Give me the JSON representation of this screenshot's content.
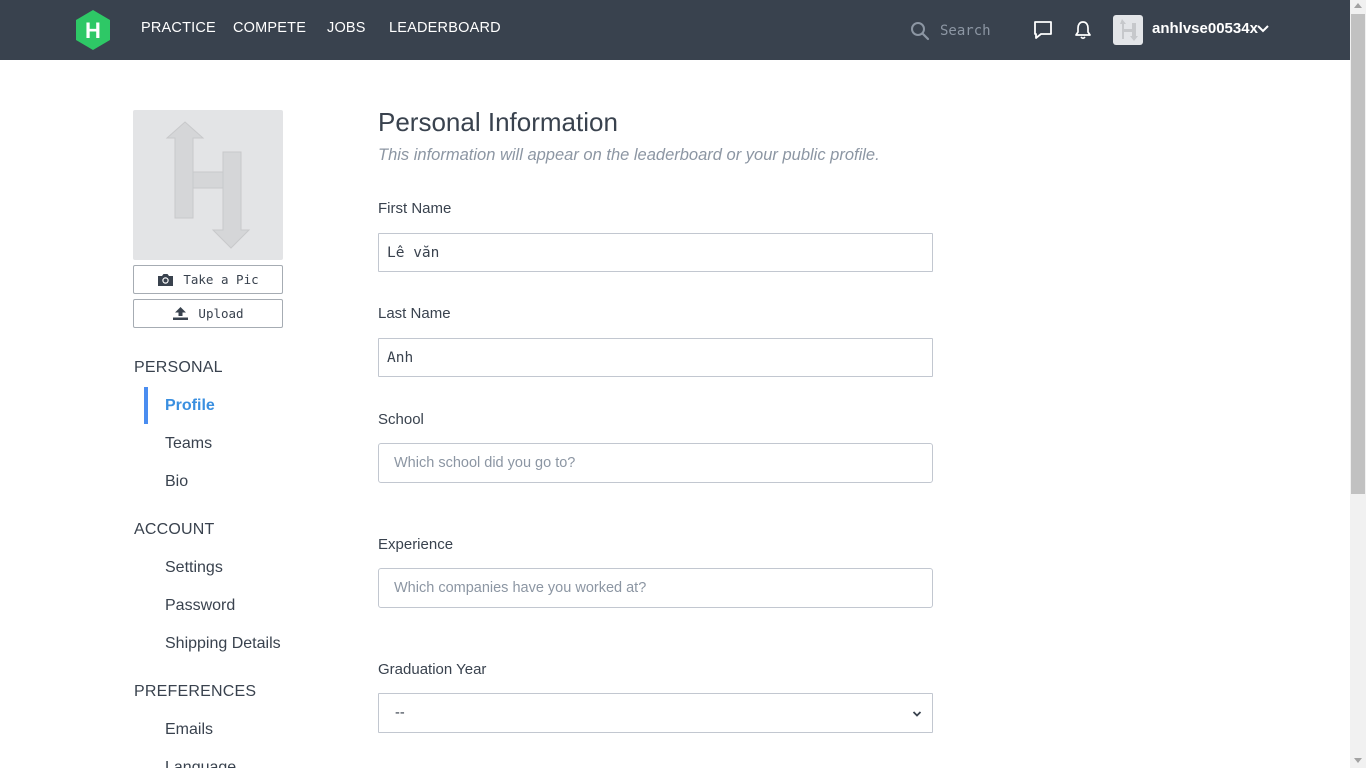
{
  "nav": {
    "links": [
      "PRACTICE",
      "COMPETE",
      "JOBS",
      "LEADERBOARD"
    ],
    "search_placeholder": "Search",
    "username": "anhlvse00534x",
    "brand_color": "#1ba94c",
    "bg_color": "#39424e",
    "icons": [
      "search-icon",
      "message-icon",
      "bell-icon",
      "chevron-down-icon"
    ]
  },
  "profile": {
    "take_pic_label": "Take a Pic",
    "upload_label": "Upload"
  },
  "sidebar": {
    "sections": [
      {
        "heading": "PERSONAL",
        "items": [
          "Profile",
          "Teams",
          "Bio"
        ]
      },
      {
        "heading": "ACCOUNT",
        "items": [
          "Settings",
          "Password",
          "Shipping Details"
        ]
      },
      {
        "heading": "PREFERENCES",
        "items": [
          "Emails",
          "Language"
        ]
      }
    ],
    "active_item": "Profile",
    "active_color": "#4a8df0"
  },
  "main": {
    "title": "Personal Information",
    "subtitle": "This information will appear on the leaderboard or your public profile.",
    "fields": {
      "first_name": {
        "label": "First Name",
        "value": "Lê văn"
      },
      "last_name": {
        "label": "Last Name",
        "value": "Anh"
      },
      "school": {
        "label": "School",
        "placeholder": "Which school did you go to?"
      },
      "experience": {
        "label": "Experience",
        "placeholder": "Which companies have you worked at?"
      },
      "graduation_year": {
        "label": "Graduation Year",
        "value": "--"
      }
    }
  }
}
